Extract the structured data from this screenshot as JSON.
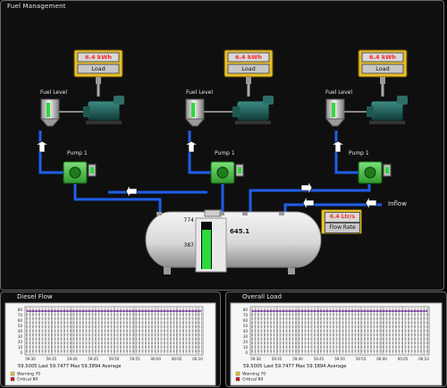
{
  "main": {
    "title": "Fuel Management"
  },
  "units": [
    {
      "load_value": "6.4 kWh",
      "load_label": "Load",
      "fuel_level_label": "Fuel Level",
      "pump_label": "Pump 1"
    },
    {
      "load_value": "6.4 kWh",
      "load_label": "Load",
      "fuel_level_label": "Fuel Level",
      "pump_label": "Pump 1"
    },
    {
      "load_value": "6.4 kWh",
      "load_label": "Load",
      "fuel_level_label": "Fuel Level",
      "pump_label": "Pump 1"
    }
  ],
  "tank": {
    "value": "645.1",
    "scale_top": "774",
    "scale_mid": "387",
    "scale_bottom": "0",
    "level_fraction": 0.83
  },
  "flow_rate": {
    "value": "6.4 Ltr/s",
    "label": "Flow Rate"
  },
  "inflow_label": "Inflow",
  "colors": {
    "pipe": "#1f5ee8",
    "level_green": "#2fd93a",
    "display_red": "#ff2a2a",
    "frame_yellow": "#e7c02a"
  },
  "trends": [
    {
      "title": "Diesel Flow",
      "y_ticks": [
        "80",
        "70",
        "60",
        "50",
        "40",
        "30",
        "20",
        "10",
        "0"
      ],
      "x_ticks": [
        "59:30",
        "59:35",
        "59:40",
        "59:45",
        "59:50",
        "59:55",
        "00:00",
        "00:05",
        "00:10"
      ],
      "stats": {
        "last": "59.5005",
        "last_label": "Last",
        "max": "59.7477",
        "max_label": "Max",
        "avg": "59.3894",
        "avg_label": "Average"
      },
      "legend": [
        {
          "name": "Warning",
          "value": "70",
          "color": "#e8c23a"
        },
        {
          "name": "Critical",
          "value": "80",
          "color": "#cc2222"
        }
      ]
    },
    {
      "title": "Overall Load",
      "y_ticks": [
        "80",
        "70",
        "60",
        "50",
        "40",
        "30",
        "20",
        "10",
        "0"
      ],
      "x_ticks": [
        "59:30",
        "59:35",
        "59:40",
        "59:45",
        "59:50",
        "59:55",
        "00:00",
        "00:05",
        "00:10"
      ],
      "stats": {
        "last": "59.5005",
        "last_label": "Last",
        "max": "59.7477",
        "max_label": "Max",
        "avg": "59.3894",
        "avg_label": "Average"
      },
      "legend": [
        {
          "name": "Warning",
          "value": "70",
          "color": "#e8c23a"
        },
        {
          "name": "Critical",
          "value": "80",
          "color": "#cc2222"
        }
      ]
    }
  ]
}
